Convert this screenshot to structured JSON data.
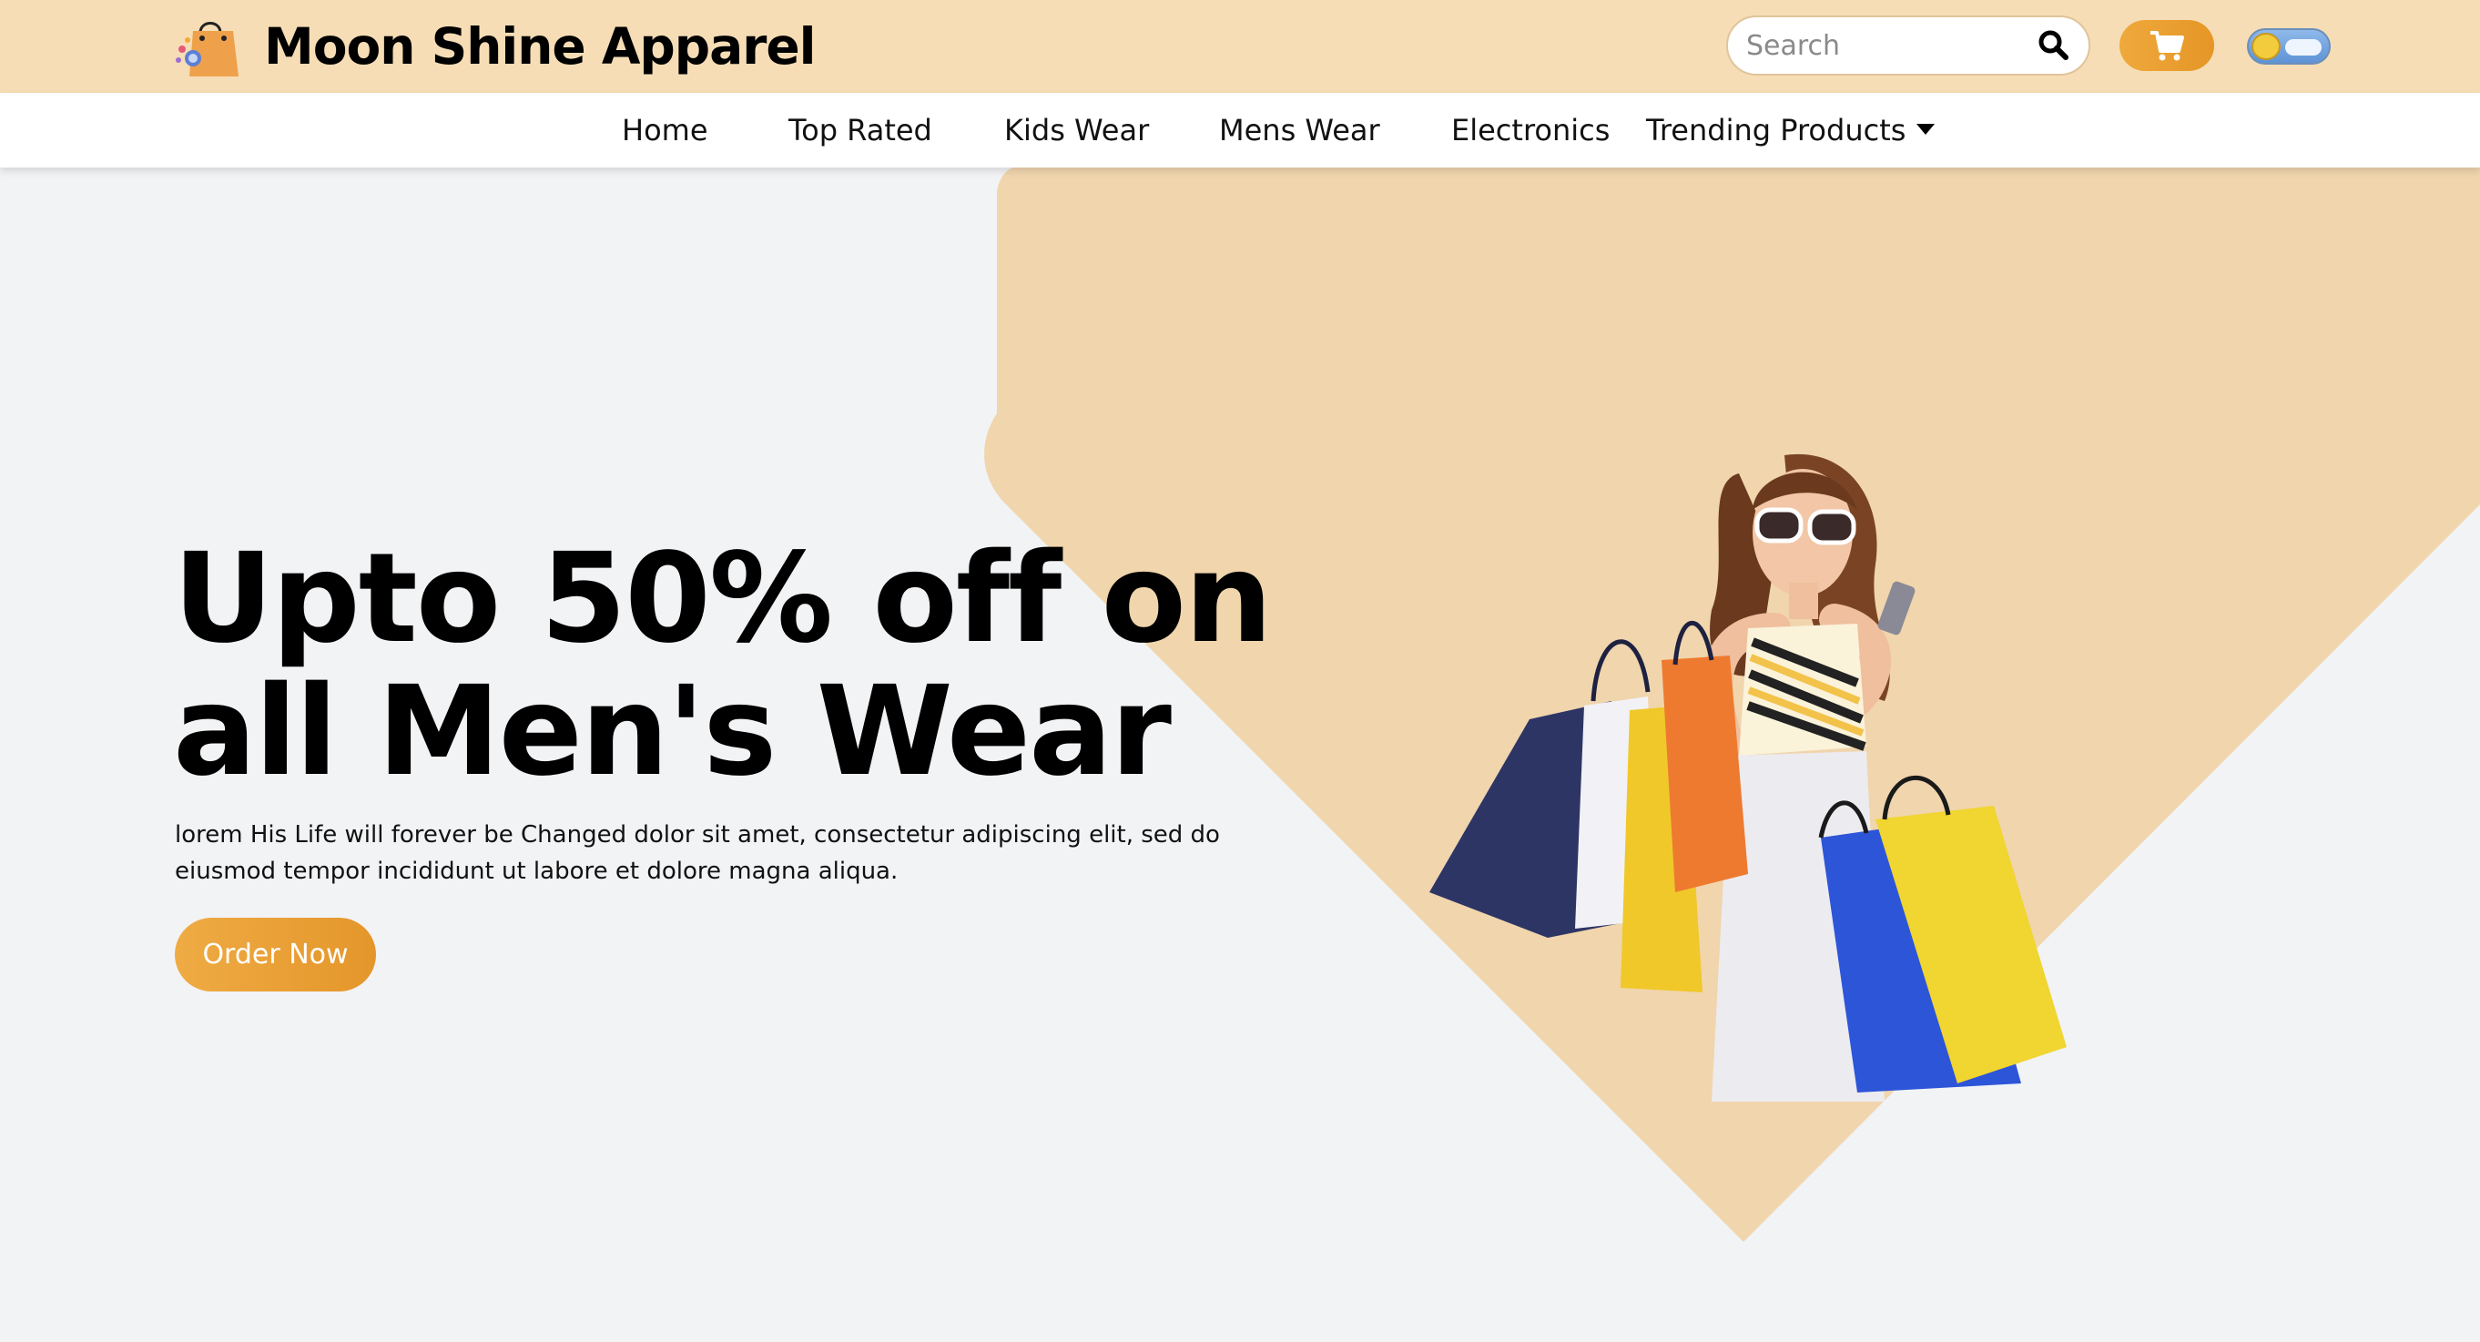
{
  "brand": {
    "name": "Moon Shine Apparel"
  },
  "header": {
    "search_placeholder": "Search",
    "cart_icon": "cart-icon",
    "search_icon": "search-icon",
    "theme_toggle_icon": "sun-cloud-toggle"
  },
  "nav": {
    "items": [
      {
        "label": "Home"
      },
      {
        "label": "Top Rated"
      },
      {
        "label": "Kids Wear"
      },
      {
        "label": "Mens Wear"
      },
      {
        "label": "Electronics"
      },
      {
        "label": "Trending Products"
      }
    ]
  },
  "hero": {
    "headline_line1": "Upto 50% off on",
    "headline_line2": "all Men's Wear",
    "description": "lorem His Life will forever be Changed dolor sit amet, consectetur adipiscing elit, sed do eiusmod tempor incididunt ut labore et dolore magna aliqua.",
    "cta_label": "Order Now"
  },
  "colors": {
    "topbar": "#f6ddb5",
    "accent": "#e8a035",
    "hero_shape": "#f0d5ad",
    "page_bg": "#f2f3f5"
  }
}
